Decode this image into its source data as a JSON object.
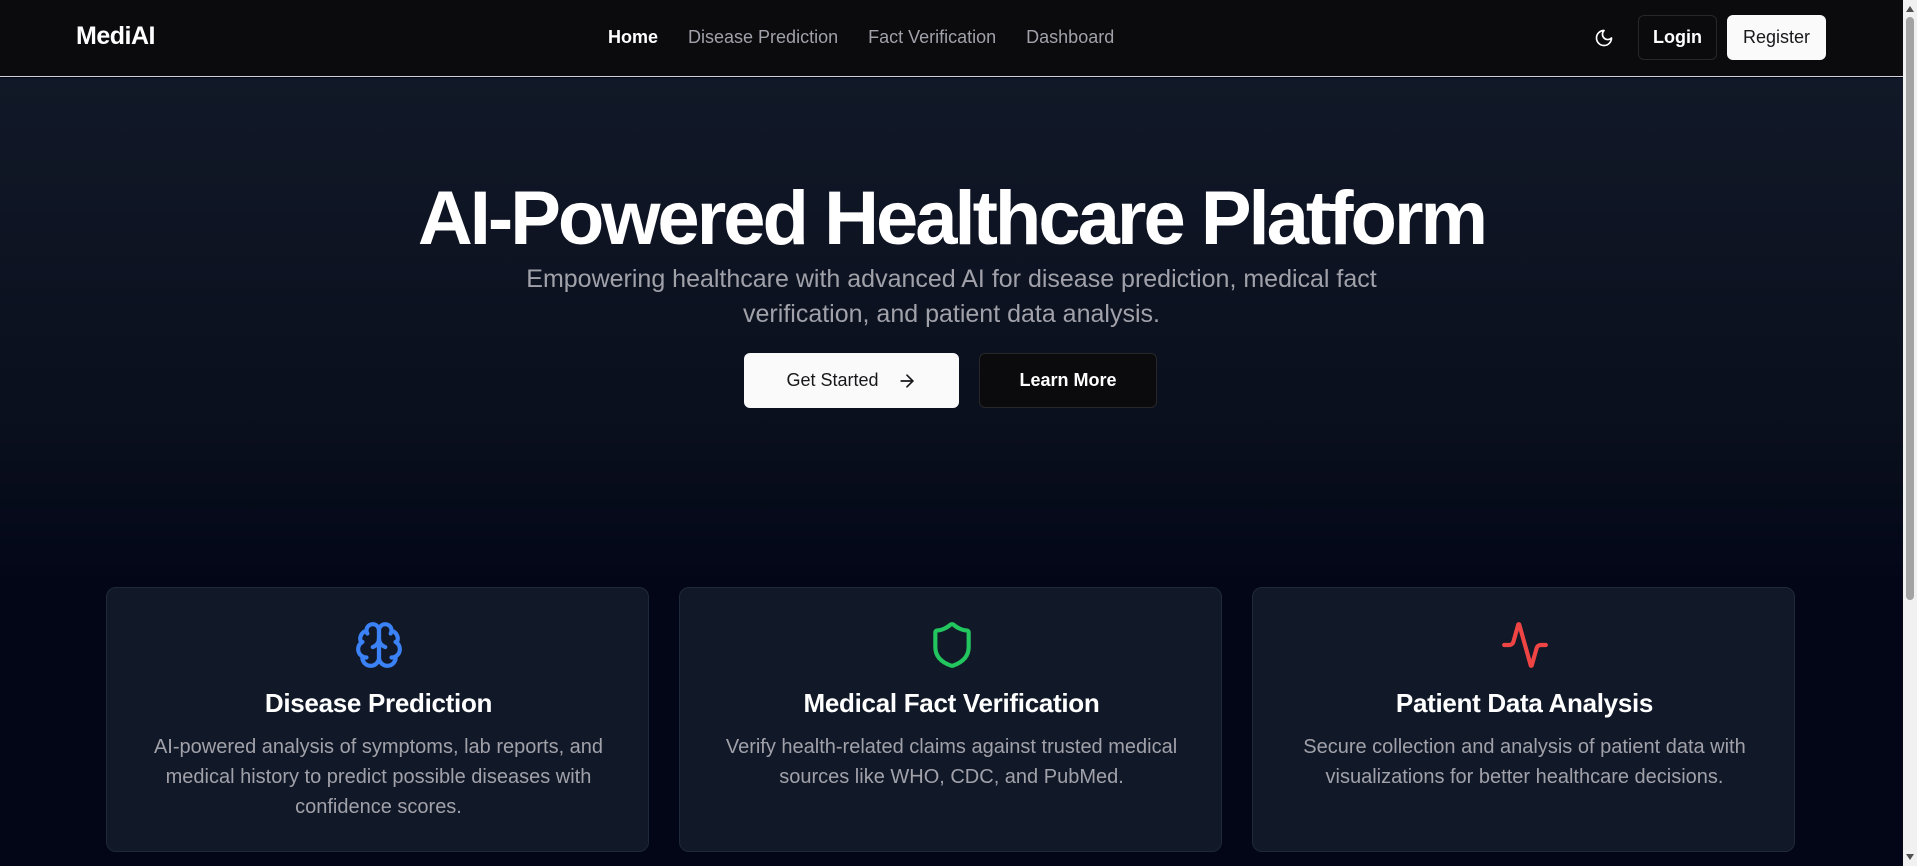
{
  "header": {
    "brand": "MediAI",
    "nav": [
      {
        "label": "Home",
        "active": true
      },
      {
        "label": "Disease Prediction",
        "active": false
      },
      {
        "label": "Fact Verification",
        "active": false
      },
      {
        "label": "Dashboard",
        "active": false
      }
    ],
    "theme_toggle_icon": "moon-icon",
    "login_label": "Login",
    "register_label": "Register"
  },
  "hero": {
    "title": "AI-Powered Healthcare Platform",
    "subtitle": "Empowering healthcare with advanced AI for disease prediction, medical fact verification, and patient data analysis.",
    "primary_cta": "Get Started",
    "primary_cta_icon": "arrow-right-icon",
    "secondary_cta": "Learn More"
  },
  "features": [
    {
      "icon": "brain-icon",
      "icon_color": "#3b82f6",
      "title": "Disease Prediction",
      "description": "AI-powered analysis of symptoms, lab reports, and medical history to predict possible diseases with confidence scores."
    },
    {
      "icon": "shield-icon",
      "icon_color": "#22c55e",
      "title": "Medical Fact Verification",
      "description": "Verify health-related claims against trusted medical sources like WHO, CDC, and PubMed."
    },
    {
      "icon": "activity-icon",
      "icon_color": "#ef4444",
      "title": "Patient Data Analysis",
      "description": "Secure collection and analysis of patient data with visualizations for better healthcare decisions."
    }
  ],
  "colors": {
    "background": "#020617",
    "header_bg": "#0b0b0d",
    "card_bg": "#111827",
    "muted_text": "#a1a1aa"
  }
}
